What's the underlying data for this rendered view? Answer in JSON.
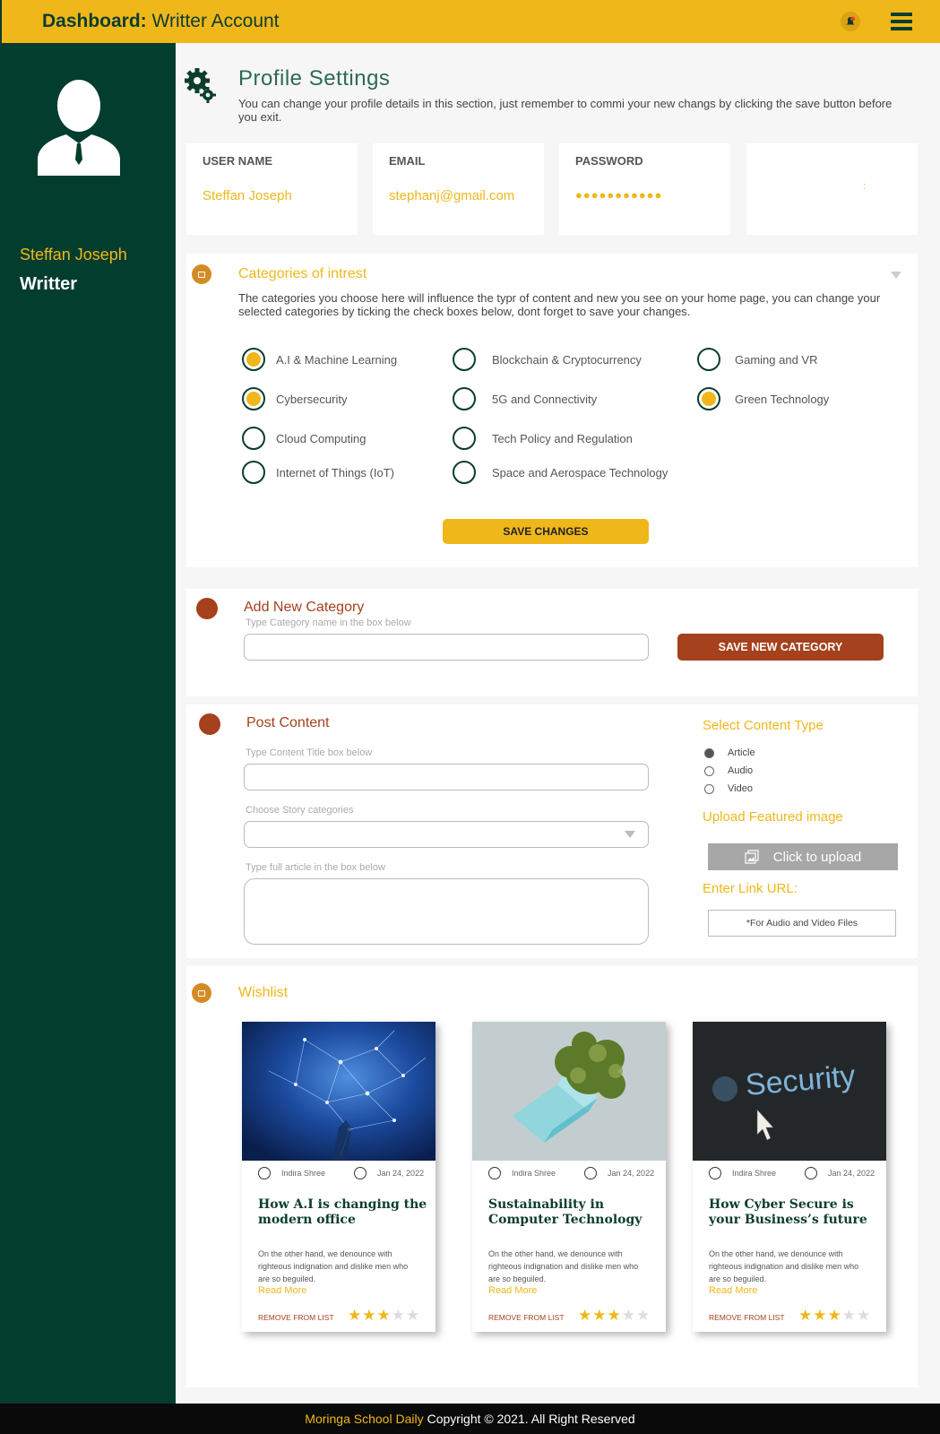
{
  "header": {
    "title_bold": "Dashboard:",
    "title_rest": " Writter Account",
    "bell_icon": "bell-icon",
    "menu_icon": "hamburger-menu-icon"
  },
  "sidebar": {
    "name": "Steffan Joseph",
    "role": "Writter"
  },
  "profile": {
    "title": "Profile Settings",
    "description": "You can change your profile details in this section, just remember to commi your new changs by clicking the save button before you exit.",
    "fields": [
      {
        "label": "USER NAME",
        "value": "Steffan Joseph"
      },
      {
        "label": "EMAIL",
        "value": "stephanj@gmail.com"
      },
      {
        "label": "PASSWORD",
        "value": "●●●●●●●●●●●"
      },
      {
        "label": "",
        "value": ":"
      }
    ]
  },
  "categories": {
    "title": "Categories of intrest",
    "description": "The categories you choose here will influence the typr of content and new you see on your home page, you can change your selected categories by ticking the check boxes below, dont forget to save your changes.",
    "items": [
      {
        "label": "A.I  & Machine Learning",
        "checked": true
      },
      {
        "label": "Blockchain & Cryptocurrency",
        "checked": false
      },
      {
        "label": "Gaming and VR",
        "checked": false
      },
      {
        "label": "Cybersecurity",
        "checked": true
      },
      {
        "label": "5G and Connectivity",
        "checked": false
      },
      {
        "label": "Green Technology",
        "checked": true
      },
      {
        "label": "Cloud Computing",
        "checked": false
      },
      {
        "label": "Tech Policy and Regulation",
        "checked": false
      },
      {
        "label": "Internet of Things (IoT)",
        "checked": false
      },
      {
        "label": "Space and Aerospace Technology",
        "checked": false
      }
    ],
    "save_label": "SAVE CHANGES"
  },
  "add_category": {
    "title": "Add New Category",
    "hint": "Type Category name in the box below",
    "input_value": "",
    "button_label": "SAVE NEW CATEGORY"
  },
  "post": {
    "title": "Post Content",
    "title_hint": "Type Content Title box below",
    "categories_hint": "Choose Story categories",
    "article_hint": "Type full article in the box below",
    "content_type_title": "Select Content Type",
    "types": [
      {
        "label": "Article",
        "selected": true
      },
      {
        "label": "Audio",
        "selected": false
      },
      {
        "label": "Video",
        "selected": false
      }
    ],
    "upload_title": "Upload Featured image",
    "upload_label": "Click to upload",
    "link_title": "Enter Link URL:",
    "link_placeholder": "*For Audio and Video Files"
  },
  "wishlist": {
    "title": "Wishlist",
    "cards": [
      {
        "author": "Indira Shree",
        "date": "Jan 24, 2022",
        "title": "How A.I is changing the modern office",
        "excerpt": "On the other hand, we denounce with righteous indignation and dislike men who are so beguiled.",
        "read_more": "Read More",
        "remove": "REMOVE FROM LIST",
        "rating": 3
      },
      {
        "author": "Indira Shree",
        "date": "Jan 24, 2022",
        "title": "Sustainability in Computer Technology",
        "excerpt": "On the other hand, we denounce with righteous indignation and dislike men who are so beguiled.",
        "read_more": "Read More",
        "remove": "REMOVE FROM LIST",
        "rating": 3
      },
      {
        "author": "Indira Shree",
        "date": "Jan 24, 2022",
        "title": "How Cyber Secure is your Business’s future",
        "excerpt": "On the other hand, we denounce with righteous indignation and dislike men who are so beguiled.",
        "read_more": "Read More",
        "remove": "REMOVE FROM LIST",
        "rating": 3,
        "image_text": "Security"
      }
    ]
  },
  "footer": {
    "brand": "Moringa School Daily",
    "copyright": "Copyright © 2021. All Right Reserved"
  },
  "colors": {
    "accent": "#f0b71b",
    "sidebar": "#023d2e",
    "rust": "#a5411d"
  }
}
